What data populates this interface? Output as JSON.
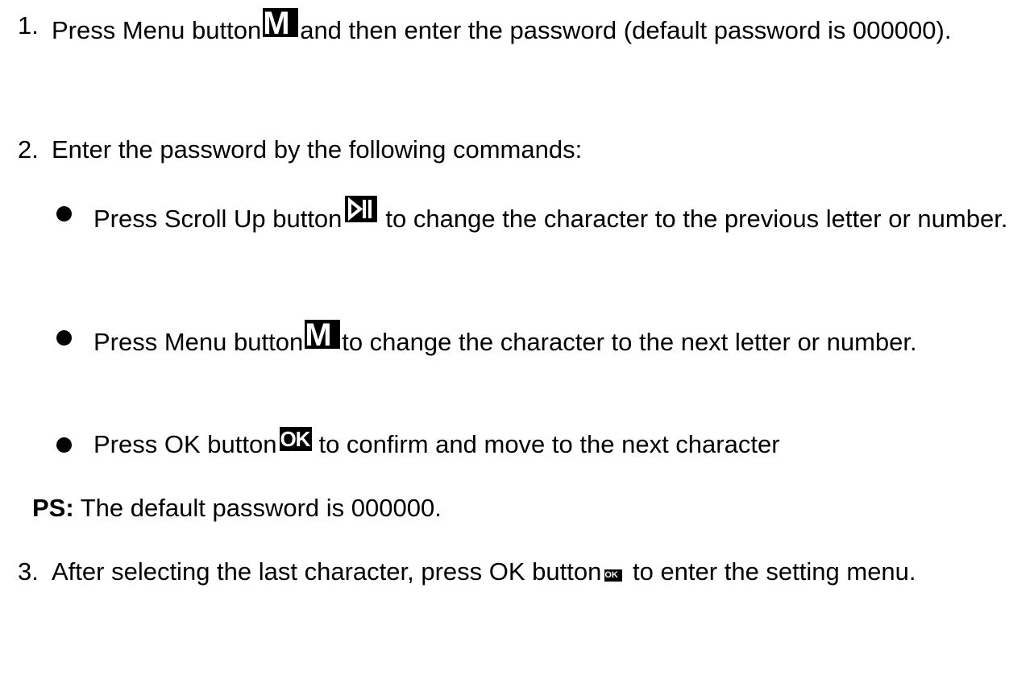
{
  "steps": [
    {
      "number": "1.",
      "before_icon": "Press Menu button",
      "icon": "menu-m-icon",
      "icon_label": "M",
      "after_icon": "and then enter the password (default password is 000000)."
    },
    {
      "number": "2.",
      "text": "Enter the password by the following commands:"
    },
    {
      "number": "3.",
      "before_icon": "After selecting the last character, press OK button",
      "icon": "ok-icon",
      "icon_label": "OK",
      "after_icon": " to enter the setting menu."
    }
  ],
  "bullets": [
    {
      "before_icon": "Press Scroll Up button",
      "icon": "play-pause-icon",
      "after_icon": "to change the character to the previous letter or number."
    },
    {
      "before_icon": "Press Menu button",
      "icon": "menu-m-icon",
      "icon_label": "M",
      "after_icon": "to change the character to the next letter or number."
    },
    {
      "before_icon": "Press OK button",
      "icon": "ok-icon",
      "icon_label": "OK",
      "after_icon": "to confirm and move to the next character"
    }
  ],
  "note": {
    "label": "PS:",
    "text": " The default password is 000000."
  }
}
